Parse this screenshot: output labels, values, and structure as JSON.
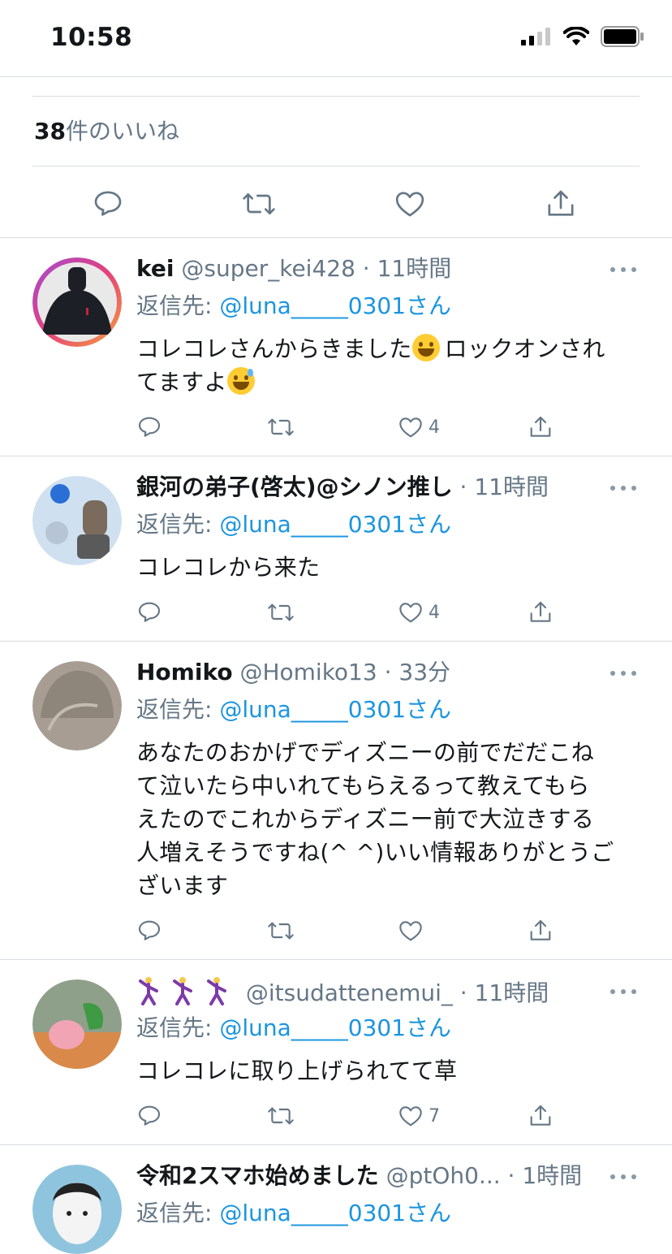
{
  "status_bar": {
    "time": "10:58"
  },
  "likes": {
    "count": "38",
    "label": "件のいいね"
  },
  "colors": {
    "link": "#1b95e0",
    "meta": "#657786",
    "divider": "#d9dde0"
  },
  "tweets": [
    {
      "name": "kei",
      "handle": "@super_kei428",
      "time": "11時間",
      "reply_prefix": "返信先: ",
      "reply_handle": "@luna_____0301さん",
      "text_a": "コレコレさんからきました",
      "text_b": "ロックオンされ",
      "text_c": "てますよ",
      "likes": "4"
    },
    {
      "name": "銀河の弟子(啓太)@シノン推し",
      "handle": "",
      "time": "11時間",
      "reply_prefix": "返信先: ",
      "reply_handle": "@luna_____0301さん",
      "text": "コレコレから来た",
      "likes": "4"
    },
    {
      "name": "Homiko",
      "handle": "@Homiko13",
      "time": "33分",
      "reply_prefix": "返信先: ",
      "reply_handle": "@luna_____0301さん",
      "text_lines": [
        "あなたのおかげでディズニーの前でだだこね",
        "て泣いたら中いれてもらえるって教えてもら",
        "えたのでこれからディズニー前で大泣きする",
        "人増えそうですね(^ ^)いい情報ありがとうご",
        "ざいます"
      ],
      "likes": ""
    },
    {
      "name": "",
      "handle": "@itsudattenemui_",
      "time": "11時間",
      "reply_prefix": "返信先: ",
      "reply_handle": "@luna_____0301さん",
      "text": "コレコレに取り上げられてて草",
      "likes": "7"
    },
    {
      "name": "令和2スマホ始めました",
      "handle": "@ptOh0...",
      "time": "1時間",
      "reply_prefix": "返信先: ",
      "reply_handle": "@luna_____0301さん"
    }
  ],
  "separator": " · "
}
